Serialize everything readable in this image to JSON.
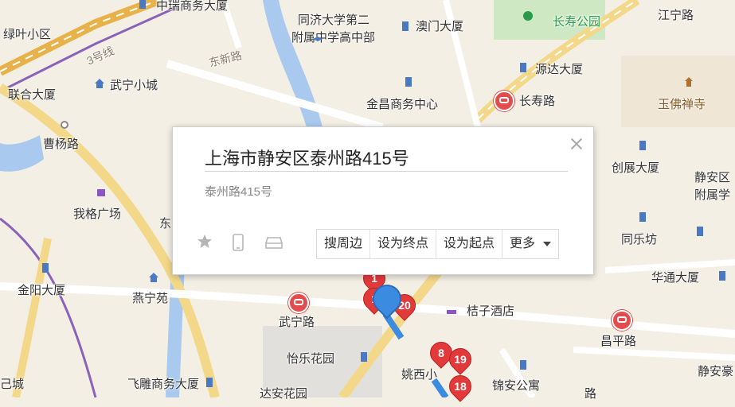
{
  "map": {
    "labels": {
      "zhongrui": "中瑞商务大厦",
      "tongji": "同济大学第二",
      "tongji2": "附属中学高中部",
      "aomen": "澳门大厦",
      "changshou_park": "长寿公园",
      "jiangning_rd": "江宁路",
      "lvye": "绿叶小区",
      "line3": "3号线",
      "dongxin_rd": "东新路",
      "lianhe": "联合大厦",
      "wuning_xc": "武宁小城",
      "yuanda": "源达大厦",
      "jinchang": "金昌商务中心",
      "changshou_rd": "长寿路",
      "yufo": "玉佛禅寺",
      "caoyang_rd": "曹杨路",
      "chuangzhan": "创展大厦",
      "jingan_fs": "静安区",
      "jingan_fs2": "附属学",
      "wogeguangchang": "我格广场",
      "dong_partial": "东",
      "tongle": "同乐坊",
      "jinyang": "金阳大厦",
      "huatong": "华通大厦",
      "yanning": "燕宁苑",
      "wuning_rd": "武宁路",
      "juzi": "桔子酒店",
      "changping_rd": "昌平路",
      "yile": "怡乐花园",
      "yaoxi": "姚西小",
      "jindong": "锦安公寓",
      "jingan_ss": "静安豪",
      "cheng": "己城",
      "feidiao": "飞雕商务大厦",
      "daan": "达安花园",
      "xx_rd": "路"
    },
    "markers": [
      "1",
      "1",
      "20",
      "8",
      "19",
      "18"
    ]
  },
  "popup": {
    "title": "上海市静安区泰州路415号",
    "subtitle": "泰州路415号",
    "actions": {
      "search_nearby": "搜周边",
      "set_end": "设为终点",
      "set_start": "设为起点",
      "more": "更多"
    }
  }
}
